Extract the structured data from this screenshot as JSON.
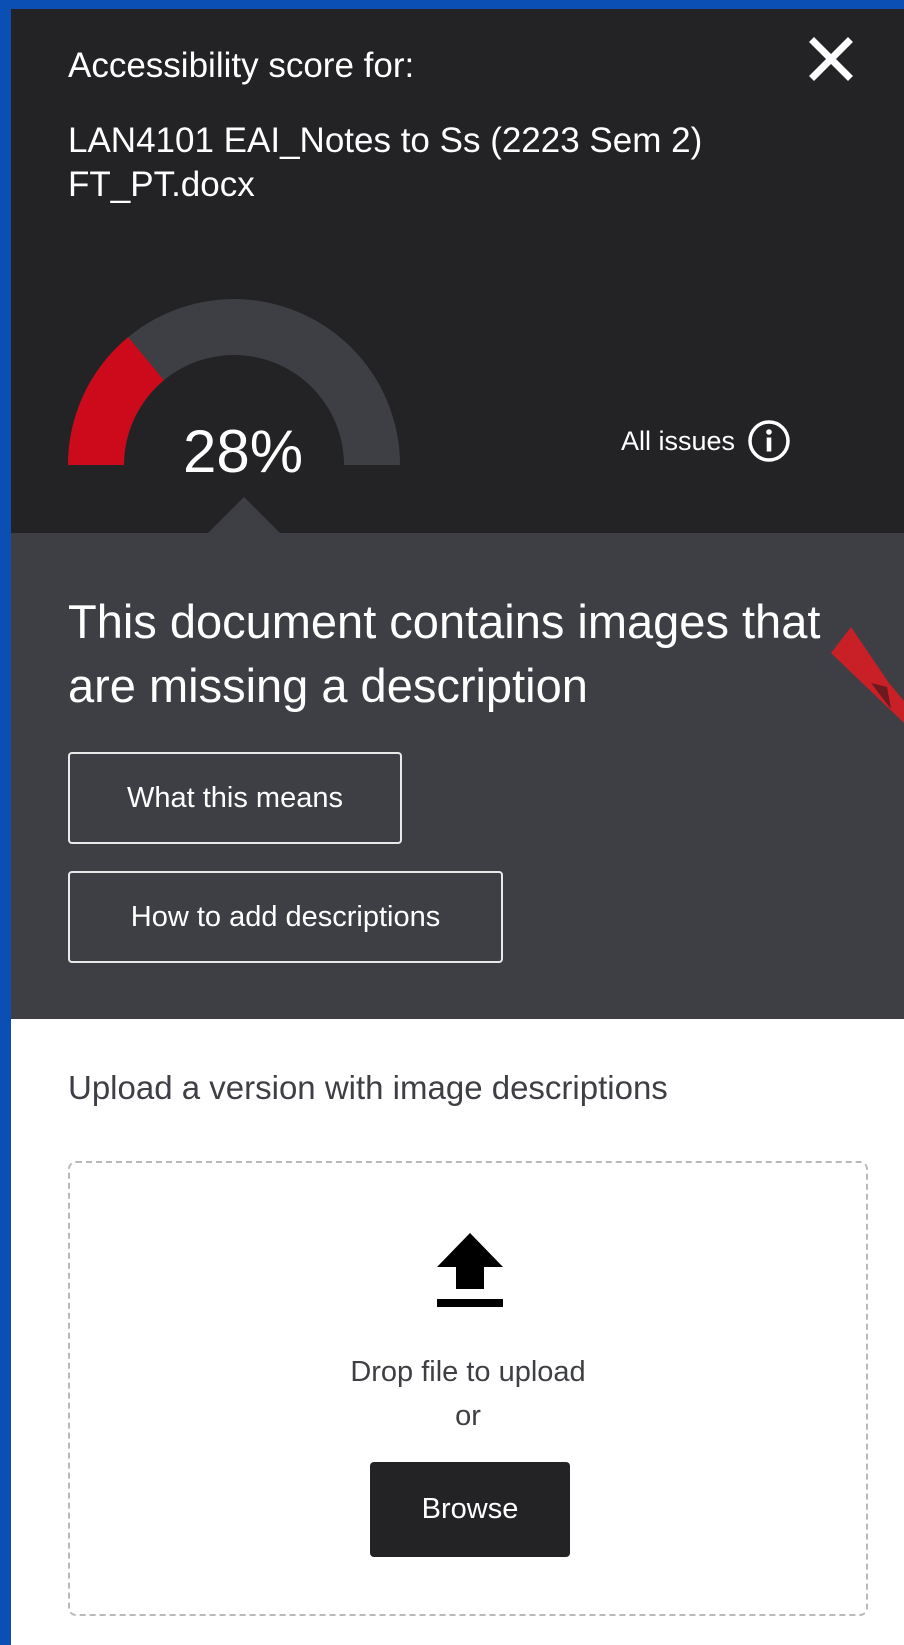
{
  "header": {
    "subtitle": "Accessibility score for:",
    "filename": "LAN4101 EAI_Notes to Ss (2223 Sem 2) FT_PT.docx",
    "close_icon": "close-icon"
  },
  "score": {
    "value": 28,
    "display": "28%",
    "fill_color": "#cc0a1c",
    "track_color": "#3e3f44"
  },
  "all_issues": {
    "label": "All issues",
    "icon": "info-icon"
  },
  "issue": {
    "title": "This document contains images that are missing a description",
    "buttons": [
      {
        "label": "What this means"
      },
      {
        "label": "How to add descriptions"
      }
    ]
  },
  "upload": {
    "label": "Upload a version with image descriptions",
    "icon": "upload-icon",
    "drop_text": "Drop file to upload",
    "or_text": "or",
    "browse_label": "Browse"
  },
  "colors": {
    "page_background": "#0b4fb5",
    "header_background": "#232325",
    "issue_background": "#3e3f44",
    "annotation_mark": "#c91f27"
  }
}
